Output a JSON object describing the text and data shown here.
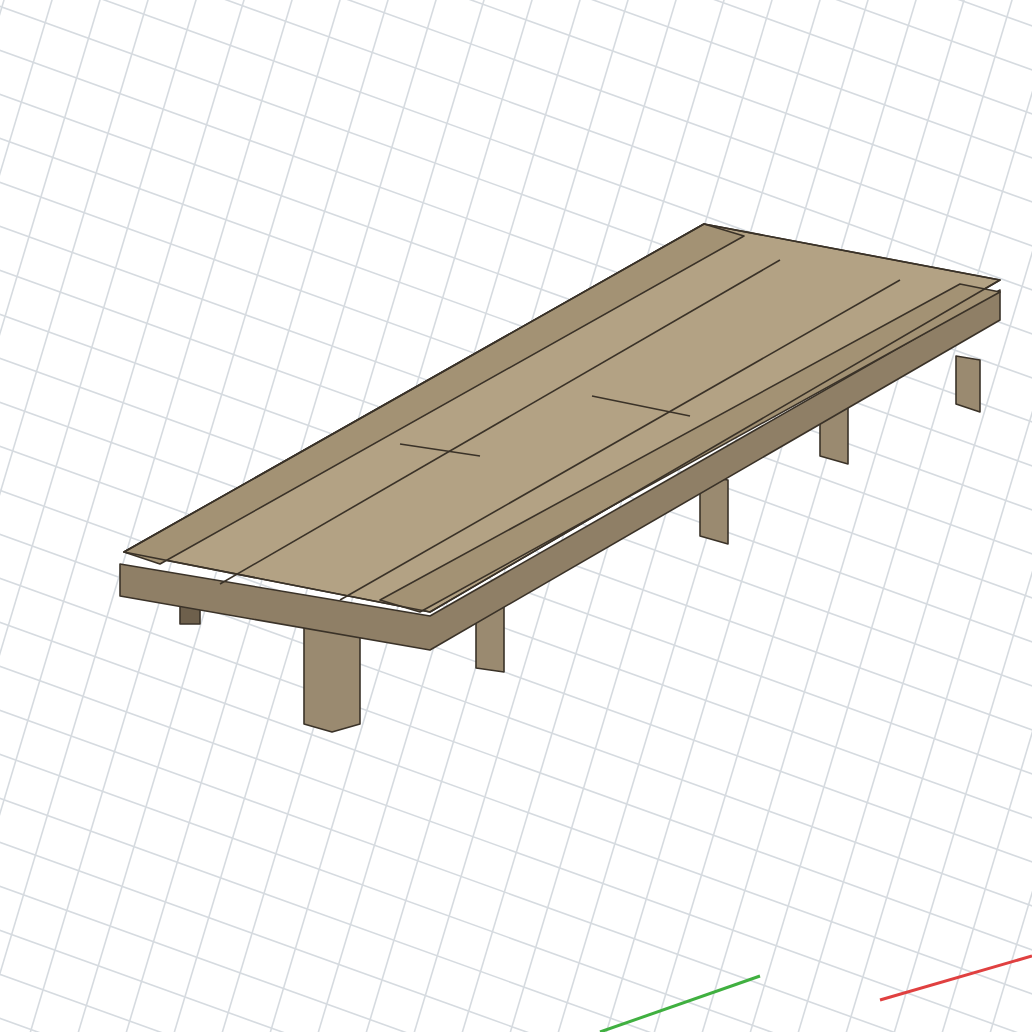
{
  "viewport": {
    "grid_visible": true,
    "axis_lines_visible": true,
    "model_visible": true
  }
}
